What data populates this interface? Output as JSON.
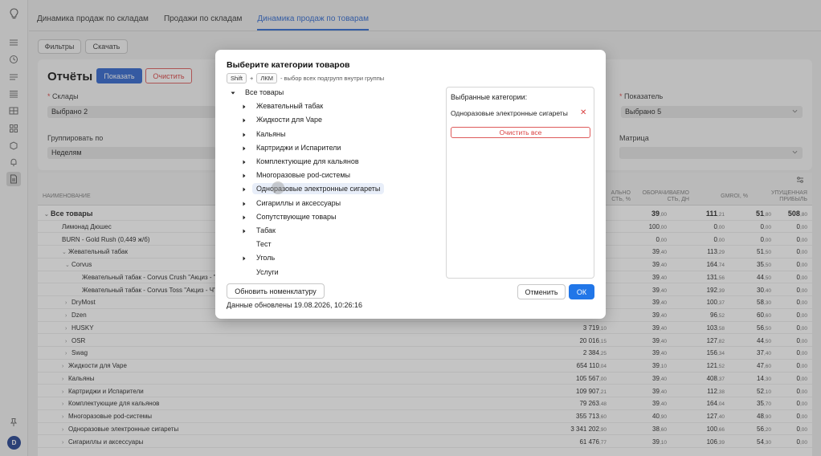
{
  "tabs": [
    {
      "label": "Динамика продаж по складам",
      "active": false
    },
    {
      "label": "Продажи по складам",
      "active": false
    },
    {
      "label": "Динамика продаж по товарам",
      "active": true
    }
  ],
  "toolbar": {
    "filters_label": "Фильтры",
    "download_label": "Скачать"
  },
  "report": {
    "title": "Отчёты",
    "show_label": "Показать",
    "clear_label": "Очистить",
    "warehouses_label": "Склады",
    "warehouses_value": "Выбрано 2",
    "indicator_label": "Показатель",
    "indicator_value": "Выбрано 5",
    "group_label": "Группировать по",
    "group_value": "Неделям",
    "matrix_label": "Матрица",
    "matrix_value": ""
  },
  "table": {
    "headers": {
      "name": "НАИМЕНОВАНИЕ",
      "col2": "АЛЬНО СТЬ, %",
      "col3": "ОБОРАЧИВАЕМО СТЬ, ДН",
      "col4": "GMROI, %",
      "col5": "УПУЩЕННАЯ ПРИБЫЛЬ"
    },
    "rows": [
      {
        "name": "Все товары",
        "caret": "⌄",
        "level": 0,
        "bold": true,
        "c1": "",
        "c2": [
          "39",
          ",00"
        ],
        "c3": [
          "111",
          ",21"
        ],
        "c4": [
          "51",
          ",80"
        ],
        "c5": [
          "508",
          ",80"
        ]
      },
      {
        "name": "Лимонад Дюшес",
        "caret": "",
        "level": 1,
        "bold": false,
        "c1": "",
        "c2": [
          "100",
          ",00"
        ],
        "c3": [
          "0",
          ",00"
        ],
        "c4": [
          "0",
          ",00"
        ],
        "c5": [
          "0",
          ",00"
        ]
      },
      {
        "name": "BURN - Gold Rush (0,449 ж/б)",
        "caret": "",
        "level": 1,
        "bold": false,
        "c1": "",
        "c2": [
          "0",
          ",00"
        ],
        "c3": [
          "0",
          ",00"
        ],
        "c4": [
          "0",
          ",00"
        ],
        "c5": [
          "0",
          ",00"
        ]
      },
      {
        "name": "Жевательный табак",
        "caret": "⌄",
        "level": 1,
        "bold": false,
        "c1": "",
        "c2": [
          "39",
          ",40"
        ],
        "c3": [
          "113",
          ",29"
        ],
        "c4": [
          "51",
          ",50"
        ],
        "c5": [
          "0",
          ",00"
        ]
      },
      {
        "name": "Corvus",
        "caret": "⌄",
        "level": 2,
        "bold": false,
        "c1": "",
        "c2": [
          "39",
          ",40"
        ],
        "c3": [
          "164",
          ",74"
        ],
        "c4": [
          "35",
          ",50"
        ],
        "c5": [
          "0",
          ",00"
        ]
      },
      {
        "name": "Жевательный табак - Corvus Crush \"Акциз - \"",
        "caret": "",
        "level": 3,
        "bold": false,
        "c1": "",
        "c2": [
          "39",
          ",40"
        ],
        "c3": [
          "131",
          ",56"
        ],
        "c4": [
          "44",
          ",50"
        ],
        "c5": [
          "0",
          ",00"
        ]
      },
      {
        "name": "Жевательный табак - Corvus Toss \"Акциз - Ч\"",
        "caret": "",
        "level": 3,
        "bold": false,
        "c1": "",
        "c2": [
          "39",
          ",40"
        ],
        "c3": [
          "192",
          ",39"
        ],
        "c4": [
          "30",
          ",40"
        ],
        "c5": [
          "0",
          ",00"
        ]
      },
      {
        "name": "DryMost",
        "caret": "›",
        "level": 2,
        "bold": false,
        "c1": "",
        "c2": [
          "39",
          ",40"
        ],
        "c3": [
          "100",
          ",37"
        ],
        "c4": [
          "58",
          ",30"
        ],
        "c5": [
          "0",
          ",00"
        ]
      },
      {
        "name": "Dzen",
        "caret": "›",
        "level": 2,
        "bold": false,
        "c1": "",
        "c2": [
          "39",
          ",40"
        ],
        "c3": [
          "96",
          ",52"
        ],
        "c4": [
          "60",
          ",60"
        ],
        "c5": [
          "0",
          ",00"
        ]
      },
      {
        "name": "HUSKY",
        "caret": "›",
        "level": 2,
        "bold": false,
        "c1": [
          "3 719",
          ",10"
        ],
        "c2": [
          "39",
          ",40"
        ],
        "c3": [
          "103",
          ",58"
        ],
        "c4": [
          "56",
          ",50"
        ],
        "c5": [
          "0",
          ",00"
        ]
      },
      {
        "name": "OSR",
        "caret": "›",
        "level": 2,
        "bold": false,
        "c1": [
          "20 016",
          ",15"
        ],
        "c2": [
          "39",
          ",40"
        ],
        "c3": [
          "127",
          ",82"
        ],
        "c4": [
          "44",
          ",50"
        ],
        "c5": [
          "0",
          ",00"
        ]
      },
      {
        "name": "Swag",
        "caret": "›",
        "level": 2,
        "bold": false,
        "c1": [
          "2 384",
          ",25"
        ],
        "c2": [
          "39",
          ",40"
        ],
        "c3": [
          "156",
          ",34"
        ],
        "c4": [
          "37",
          ",40"
        ],
        "c5": [
          "0",
          ",00"
        ]
      },
      {
        "name": "Жидкости для Vape",
        "caret": "›",
        "level": 1,
        "bold": false,
        "c1": [
          "654 110",
          ",04"
        ],
        "c2": [
          "39",
          ",10"
        ],
        "c3": [
          "121",
          ",52"
        ],
        "c4": [
          "47",
          ",60"
        ],
        "c5": [
          "0",
          ",00"
        ]
      },
      {
        "name": "Кальяны",
        "caret": "›",
        "level": 1,
        "bold": false,
        "c1": [
          "105 567",
          ",00"
        ],
        "c2": [
          "39",
          ",40"
        ],
        "c3": [
          "408",
          ",37"
        ],
        "c4": [
          "14",
          ",30"
        ],
        "c5": [
          "0",
          ",00"
        ]
      },
      {
        "name": "Картриджи и Испарители",
        "caret": "›",
        "level": 1,
        "bold": false,
        "c1": [
          "109 907",
          ",21"
        ],
        "c2": [
          "39",
          ",40"
        ],
        "c3": [
          "112",
          ",38"
        ],
        "c4": [
          "52",
          ",10"
        ],
        "c5": [
          "0",
          ",00"
        ]
      },
      {
        "name": "Комплектующие для кальянов",
        "caret": "›",
        "level": 1,
        "bold": false,
        "c1": [
          "79 263",
          ",48"
        ],
        "c2": [
          "39",
          ",40"
        ],
        "c3": [
          "164",
          ",04"
        ],
        "c4": [
          "35",
          ",70"
        ],
        "c5": [
          "0",
          ",00"
        ]
      },
      {
        "name": "Многоразовые pod-системы",
        "caret": "›",
        "level": 1,
        "bold": false,
        "c1": [
          "355 713",
          ",60"
        ],
        "c2": [
          "40",
          ",90"
        ],
        "c3": [
          "127",
          ",40"
        ],
        "c4": [
          "48",
          ",90"
        ],
        "c5": [
          "0",
          ",00"
        ]
      },
      {
        "name": "Одноразовые электронные сигареты",
        "caret": "›",
        "level": 1,
        "bold": false,
        "c1": [
          "3 341 202",
          ",90"
        ],
        "c2": [
          "38",
          ",60"
        ],
        "c3": [
          "100",
          ",66"
        ],
        "c4": [
          "56",
          ",20"
        ],
        "c5": [
          "0",
          ",00"
        ]
      },
      {
        "name": "Сигариллы и аксессуары",
        "caret": "›",
        "level": 1,
        "bold": false,
        "c1": [
          "61 476",
          ",77"
        ],
        "c2": [
          "39",
          ",10"
        ],
        "c3": [
          "106",
          ",39"
        ],
        "c4": [
          "54",
          ",30"
        ],
        "c5": [
          "0",
          ",00"
        ]
      }
    ]
  },
  "modal": {
    "title": "Выберите категории товаров",
    "hint_key1": "Shift",
    "hint_plus": "+",
    "hint_key2": "ЛКМ",
    "hint_text": "- выбор всех подгрупп внутри группы",
    "tree": [
      {
        "label": "Все товары",
        "expanded": true,
        "has_children": true,
        "level": 0,
        "highlight": false
      },
      {
        "label": "Жевательный табак",
        "expanded": false,
        "has_children": true,
        "level": 1,
        "highlight": false
      },
      {
        "label": "Жидкости для Vape",
        "expanded": false,
        "has_children": true,
        "level": 1,
        "highlight": false
      },
      {
        "label": "Кальяны",
        "expanded": false,
        "has_children": true,
        "level": 1,
        "highlight": false
      },
      {
        "label": "Картриджи и Испарители",
        "expanded": false,
        "has_children": true,
        "level": 1,
        "highlight": false
      },
      {
        "label": "Комплектующие для кальянов",
        "expanded": false,
        "has_children": true,
        "level": 1,
        "highlight": false
      },
      {
        "label": "Многоразовые pod-системы",
        "expanded": false,
        "has_children": true,
        "level": 1,
        "highlight": false
      },
      {
        "label": "Одноразовые электронные сигареты",
        "expanded": false,
        "has_children": true,
        "level": 1,
        "highlight": true
      },
      {
        "label": "Сигариллы и аксессуары",
        "expanded": false,
        "has_children": true,
        "level": 1,
        "highlight": false
      },
      {
        "label": "Сопутствующие товары",
        "expanded": false,
        "has_children": true,
        "level": 1,
        "highlight": false
      },
      {
        "label": "Табак",
        "expanded": false,
        "has_children": true,
        "level": 1,
        "highlight": false
      },
      {
        "label": "Тест",
        "expanded": false,
        "has_children": false,
        "level": 1,
        "highlight": false
      },
      {
        "label": "Уголь",
        "expanded": false,
        "has_children": true,
        "level": 1,
        "highlight": false
      },
      {
        "label": "Услуги",
        "expanded": false,
        "has_children": false,
        "level": 1,
        "highlight": false
      }
    ],
    "selected_title": "Выбранные категории:",
    "selected_items": [
      "Одноразовые электронные сигареты"
    ],
    "clear_all_label": "Очистить все",
    "update_label": "Обновить номенклатуру",
    "updated_text": "Данные обновлены 19.08.2026, 10:26:16",
    "cancel_label": "Отменить",
    "ok_label": "ОК"
  },
  "user": {
    "avatar_initial": "D"
  },
  "colors": {
    "primary": "#2d63cd",
    "ok": "#2176e8",
    "danger": "#d94040",
    "active_tab": "#2d67cf"
  }
}
